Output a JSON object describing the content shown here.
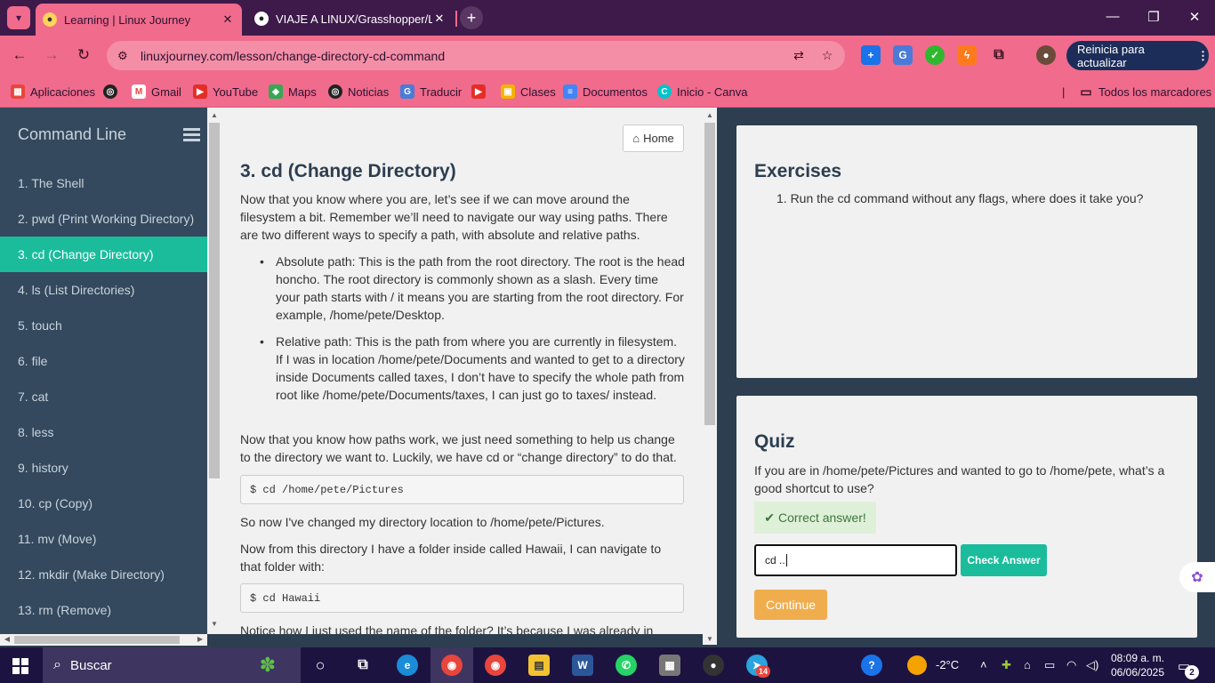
{
  "browser": {
    "tabs": [
      {
        "title": "Learning | Linux Journey",
        "active": true
      },
      {
        "title": "VIAJE A LINUX/Grasshopper/Lin",
        "active": false
      }
    ],
    "url": "linuxjourney.com/lesson/change-directory-cd-command",
    "update_label": "Reinicia para actualizar",
    "bookmarks": [
      {
        "label": "Aplicaciones",
        "icon": "apps-grid-icon"
      },
      {
        "label": "",
        "icon": "chrome-globe-icon"
      },
      {
        "label": "Gmail",
        "icon": "gmail-icon"
      },
      {
        "label": "YouTube",
        "icon": "youtube-icon"
      },
      {
        "label": "Maps",
        "icon": "maps-icon"
      },
      {
        "label": "Noticias",
        "icon": "news-icon"
      },
      {
        "label": "Traducir",
        "icon": "translate-icon"
      },
      {
        "label": "",
        "icon": "youtube-icon"
      },
      {
        "label": "Clases",
        "icon": "classroom-icon"
      },
      {
        "label": "Documentos",
        "icon": "docs-icon"
      },
      {
        "label": "Inicio - Canva",
        "icon": "canva-icon"
      }
    ],
    "all_bookmarks": "Todos los marcadores"
  },
  "sidebar": {
    "title": "Command Line",
    "items": [
      "1. The Shell",
      "2. pwd (Print Working Directory)",
      "3. cd (Change Directory)",
      "4. ls (List Directories)",
      "5. touch",
      "6. file",
      "7. cat",
      "8. less",
      "9. history",
      "10. cp (Copy)",
      "11. mv (Move)",
      "12. mkdir (Make Directory)",
      "13. rm (Remove)"
    ],
    "active_index": 2
  },
  "lesson": {
    "home_label": "Home",
    "title": "3. cd (Change Directory)",
    "intro": "Now that you know where you are, let’s see if we can move around the filesystem a bit. Remember we’ll need to navigate our way using paths. There are two different ways to specify a path, with absolute and relative paths.",
    "bullets": [
      "Absolute path: This is the path from the root directory. The root is the head honcho. The root directory is commonly shown as a slash. Every time your path starts with / it means you are starting from the root directory. For example, /home/pete/Desktop.",
      "Relative path: This is the path from where you are currently in filesystem. If I was in location /home/pete/Documents and wanted to get to a directory inside Documents called taxes, I don’t have to specify the whole path from root like /home/pete/Documents/taxes, I can just go to taxes/ instead."
    ],
    "para2": "Now that you know how paths work, we just need something to help us change to the directory we want to. Luckily, we have cd or “change directory” to do that.",
    "code1": "$ cd /home/pete/Pictures",
    "para3": "So now I've changed my directory location to /home/pete/Pictures.",
    "para4": "Now from this directory I have a folder inside called Hawaii, I can navigate to that folder with:",
    "code2": "$ cd Hawaii",
    "para5": "Notice how I just used the name of the folder? It’s because I was already in /home/pete/Pictures."
  },
  "exercises": {
    "title": "Exercises",
    "items": [
      "1. Run the cd command without any flags, where does it take you?"
    ]
  },
  "quiz": {
    "title": "Quiz",
    "question": "If you are in /home/pete/Pictures and wanted to go to /home/pete, what’s a good shortcut to use?",
    "feedback": "Correct answer!",
    "answer_value": "cd ..",
    "check_label": "Check Answer",
    "continue_label": "Continue"
  },
  "taskbar": {
    "search_placeholder": "Buscar",
    "weather": "-2°C",
    "time": "08:09 a. m.",
    "date": "06/06/2025",
    "notifications": "2",
    "telegram_badge": "14"
  }
}
